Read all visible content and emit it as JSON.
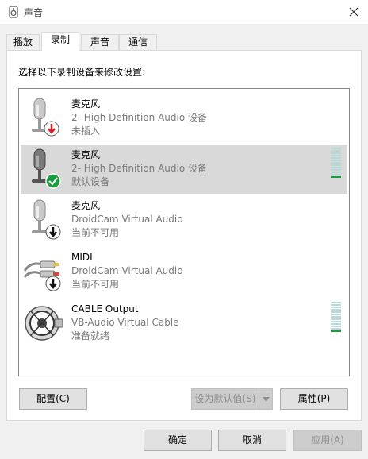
{
  "window": {
    "title": "声音"
  },
  "tabs": [
    {
      "label": "播放"
    },
    {
      "label": "录制"
    },
    {
      "label": "声音"
    },
    {
      "label": "通信"
    }
  ],
  "instruction": "选择以下录制设备来修改设置:",
  "devices": [
    {
      "name": "麦克风",
      "description": "2- High Definition Audio 设备",
      "status": "未插入",
      "icon": "microphone-icon",
      "badge": "unplugged-badge-red",
      "selected": false,
      "level": null
    },
    {
      "name": "麦克风",
      "description": "2- High Definition Audio 设备",
      "status": "默认设备",
      "icon": "microphone-icon",
      "badge": "default-check-badge-green",
      "selected": true,
      "level": 0.05
    },
    {
      "name": "麦克风",
      "description": "DroidCam Virtual Audio",
      "status": "当前不可用",
      "icon": "microphone-icon",
      "badge": "down-arrow-badge-black",
      "selected": false,
      "level": null
    },
    {
      "name": "MIDI",
      "description": "DroidCam Virtual Audio",
      "status": "当前不可用",
      "icon": "rca-jack-icon",
      "badge": "down-arrow-badge-black",
      "selected": false,
      "level": null
    },
    {
      "name": "CABLE Output",
      "description": "VB-Audio Virtual Cable",
      "status": "准备就绪",
      "icon": "cable-reel-icon",
      "badge": null,
      "selected": false,
      "level": 0.05
    }
  ],
  "buttons": {
    "configure": "配置(C)",
    "set_default": "设为默认值(S)",
    "properties": "属性(P)",
    "ok": "确定",
    "cancel": "取消",
    "apply": "应用(A)"
  },
  "colors": {
    "selection": "#d9d9d9",
    "meter_idle": "#b9d7d6",
    "meter_active": "#1a9c3e",
    "check_green": "#1a9c3e",
    "unplugged_red": "#d42020"
  }
}
